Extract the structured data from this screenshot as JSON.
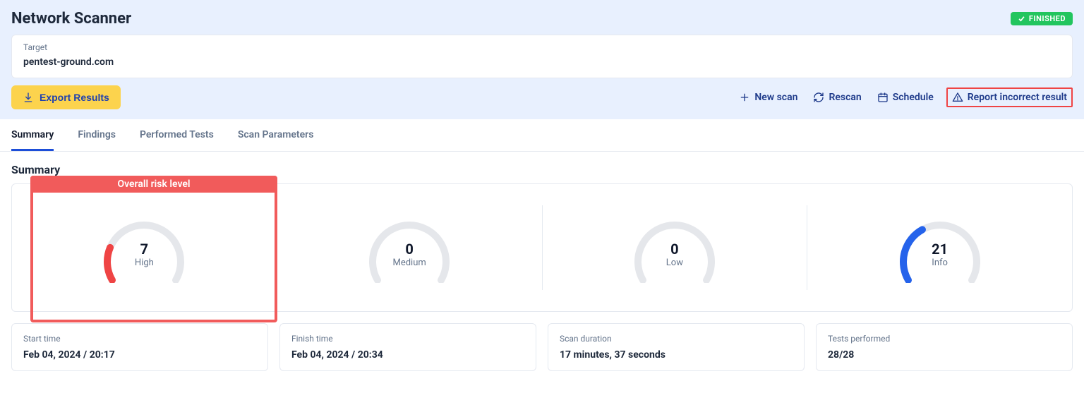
{
  "header": {
    "title": "Network Scanner",
    "status": "FINISHED"
  },
  "target": {
    "label": "Target",
    "value": "pentest-ground.com"
  },
  "toolbar": {
    "export": "Export Results",
    "new_scan": "New scan",
    "rescan": "Rescan",
    "schedule": "Schedule",
    "report": "Report incorrect result"
  },
  "tabs": {
    "summary": "Summary",
    "findings": "Findings",
    "performed": "Performed Tests",
    "params": "Scan Parameters"
  },
  "summary": {
    "heading": "Summary",
    "overall_label": "Overall risk level",
    "gauges": {
      "high": {
        "value": "7",
        "label": "High",
        "color": "#ef4444",
        "fraction": 0.22
      },
      "medium": {
        "value": "0",
        "label": "Medium",
        "color": "#f59e0b",
        "fraction": 0.0
      },
      "low": {
        "value": "0",
        "label": "Low",
        "color": "#10b981",
        "fraction": 0.0
      },
      "info": {
        "value": "21",
        "label": "Info",
        "color": "#2563eb",
        "fraction": 0.38
      }
    }
  },
  "stats": {
    "start": {
      "label": "Start time",
      "value": "Feb 04, 2024 / 20:17"
    },
    "finish": {
      "label": "Finish time",
      "value": "Feb 04, 2024 / 20:34"
    },
    "duration": {
      "label": "Scan duration",
      "value": "17 minutes, 37 seconds"
    },
    "tests": {
      "label": "Tests performed",
      "value": "28/28"
    }
  }
}
